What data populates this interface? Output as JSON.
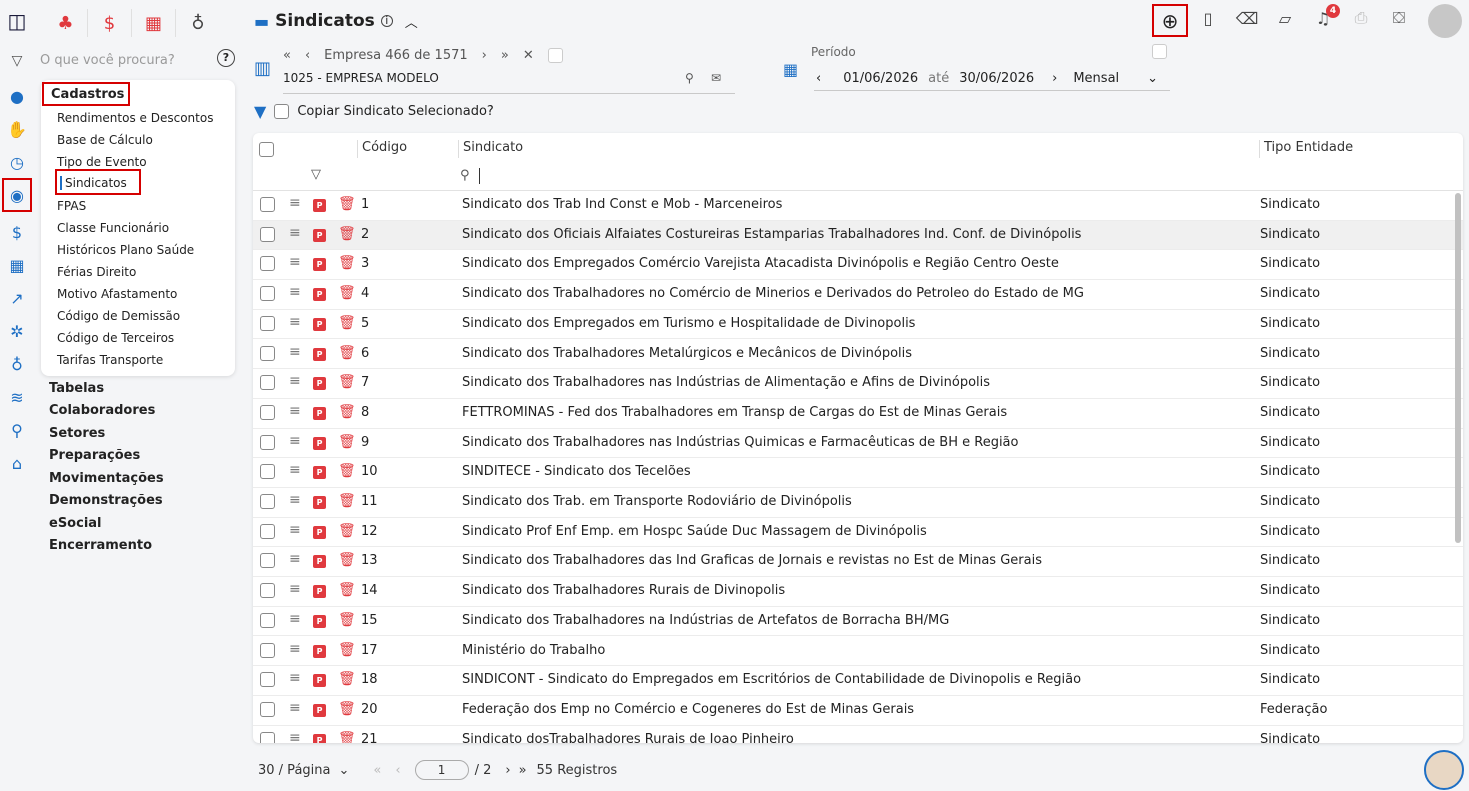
{
  "search": {
    "placeholder": "O que você procura?",
    "help": "?"
  },
  "menu": {
    "group_title": "Cadastros",
    "items": [
      "Rendimentos e Descontos",
      "Base de Cálculo",
      "Tipo de Evento",
      "Sindicatos",
      "FPAS",
      "Classe Funcionário",
      "Históricos Plano Saúde",
      "Férias Direito",
      "Motivo Afastamento",
      "Código de Demissão",
      "Código de Terceiros",
      "Tarifas Transporte"
    ],
    "selected": "Sindicatos",
    "sections": [
      "Tabelas",
      "Colaboradores",
      "Setores",
      "Preparações",
      "Movimentações",
      "Demonstrações",
      "eSocial",
      "Encerramento"
    ]
  },
  "header": {
    "title": "Sindicatos",
    "bell_count": "4"
  },
  "empresa": {
    "nav_text": "Empresa 466 de 1571",
    "name": "1025 - EMPRESA MODELO"
  },
  "periodo": {
    "label": "Período",
    "start": "01/06/2026",
    "sep": "até",
    "end": "30/06/2026",
    "mode": "Mensal"
  },
  "copy_label": "Copiar Sindicato Selecionado?",
  "table": {
    "headers": {
      "code": "Código",
      "name": "Sindicato",
      "type": "Tipo Entidade"
    },
    "rows": [
      {
        "code": "1",
        "name": "Sindicato dos Trab Ind Const e Mob - Marceneiros",
        "type": "Sindicato"
      },
      {
        "code": "2",
        "name": "Sindicato dos Oficiais Alfaiates Costureiras Estamparias Trabalhadores Ind. Conf. de Divinópolis",
        "type": "Sindicato"
      },
      {
        "code": "3",
        "name": "Sindicato dos Empregados Comércio Varejista Atacadista Divinópolis e Região Centro Oeste",
        "type": "Sindicato"
      },
      {
        "code": "4",
        "name": "Sindicato dos Trabalhadores no Comércio de Minerios e Derivados do Petroleo do Estado de MG",
        "type": "Sindicato"
      },
      {
        "code": "5",
        "name": "Sindicato dos Empregados em Turismo e Hospitalidade de Divinopolis",
        "type": "Sindicato"
      },
      {
        "code": "6",
        "name": "Sindicato dos Trabalhadores Metalúrgicos e Mecânicos de Divinópolis",
        "type": "Sindicato"
      },
      {
        "code": "7",
        "name": "Sindicato dos Trabalhadores nas Indústrias de Alimentação e Afins de Divinópolis",
        "type": "Sindicato"
      },
      {
        "code": "8",
        "name": "FETTROMINAS - Fed dos Trabalhadores em Transp de Cargas do Est de Minas Gerais",
        "type": "Sindicato"
      },
      {
        "code": "9",
        "name": "Sindicato dos Trabalhadores nas Indústrias Quimicas e Farmacêuticas de BH e Região",
        "type": "Sindicato"
      },
      {
        "code": "10",
        "name": "SINDITECE - Sindicato dos Tecelões",
        "type": "Sindicato"
      },
      {
        "code": "11",
        "name": "Sindicato dos Trab. em Transporte Rodoviário de Divinópolis",
        "type": "Sindicato"
      },
      {
        "code": "12",
        "name": "Sindicato Prof Enf Emp. em Hospc Saúde Duc Massagem de Divinópolis",
        "type": "Sindicato"
      },
      {
        "code": "13",
        "name": "Sindicato dos Trabalhadores das Ind Graficas de Jornais e revistas no Est de Minas Gerais",
        "type": "Sindicato"
      },
      {
        "code": "14",
        "name": "Sindicato dos Trabalhadores Rurais de Divinopolis",
        "type": "Sindicato"
      },
      {
        "code": "15",
        "name": "Sindicato dos Trabalhadores na Indústrias de Artefatos de Borracha BH/MG",
        "type": "Sindicato"
      },
      {
        "code": "17",
        "name": "Ministério do Trabalho",
        "type": "Sindicato"
      },
      {
        "code": "18",
        "name": "SINDICONT - Sindicato do Empregados em Escritórios de Contabilidade de Divinopolis e Região",
        "type": "Sindicato"
      },
      {
        "code": "20",
        "name": "Federação dos Emp no Comércio e Cogeneres do Est de Minas Gerais",
        "type": "Federação"
      },
      {
        "code": "21",
        "name": "Sindicato dosTrabalhadores Rurais de Joao Pinheiro",
        "type": "Sindicato"
      }
    ],
    "highlighted_row": 1
  },
  "footer": {
    "per_page": "30 / Página",
    "page": "1",
    "total_pages": "/ 2",
    "records": "55 Registros"
  },
  "colors": {
    "accent": "#1e6fc4",
    "danger": "#e0393e",
    "highlight_border": "#d50000"
  }
}
